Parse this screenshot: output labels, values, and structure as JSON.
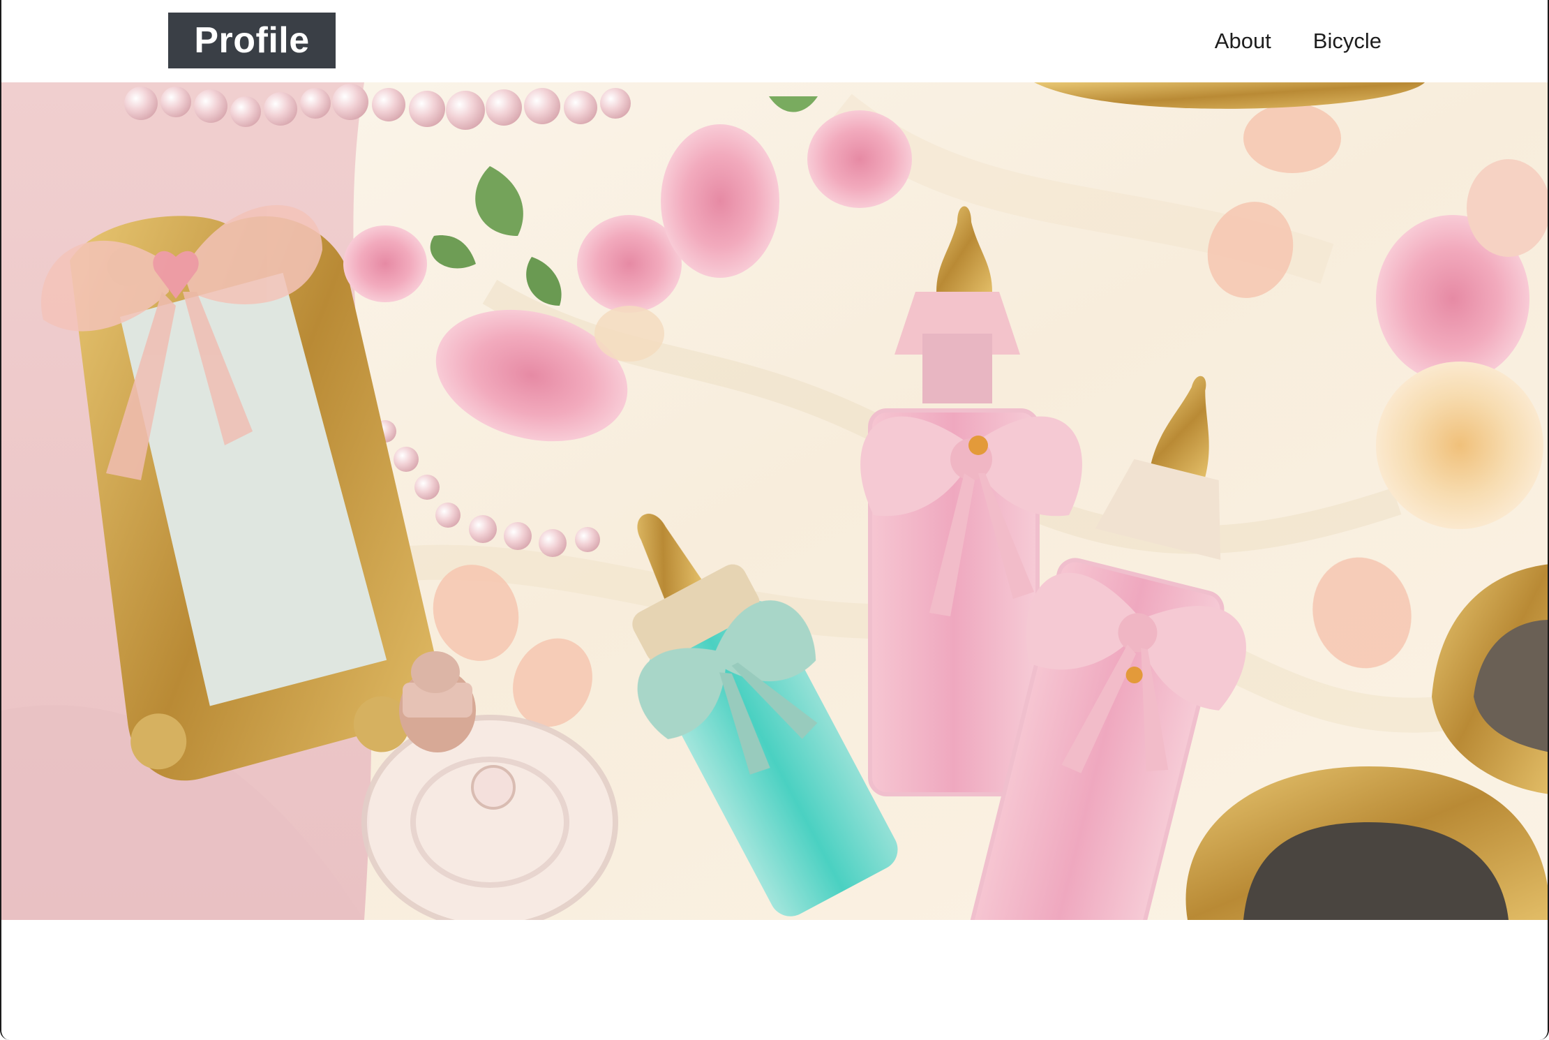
{
  "header": {
    "logo_text": "Profile",
    "nav": [
      {
        "label": "About"
      },
      {
        "label": "Bicycle"
      }
    ]
  },
  "hero": {
    "image_alt": "",
    "palette": {
      "silk": "#fbf3e6",
      "blush": "#f3cfd3",
      "rose": "#f2a9bd",
      "gold": "#c9a04a",
      "aqua": "#5ed6c9",
      "pearl": "#f3d2d4"
    }
  }
}
